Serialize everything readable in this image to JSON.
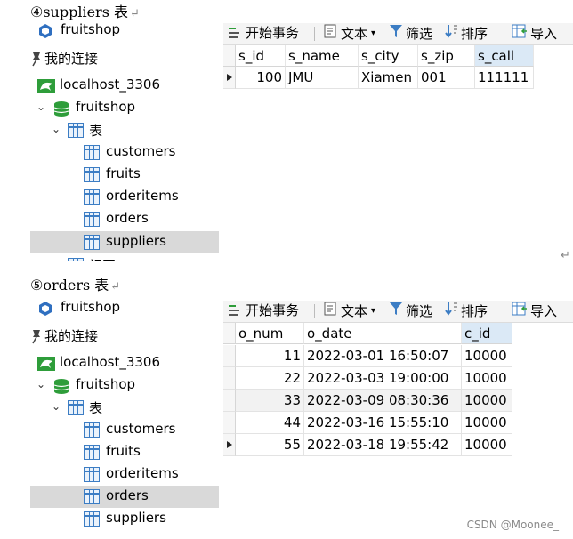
{
  "section1": {
    "heading": "④suppliers 表",
    "tree": {
      "root_label": "fruitshop",
      "connection_label": "我的连接",
      "server_label": "localhost_3306",
      "db_label": "fruitshop",
      "tables_label": "表",
      "tables": [
        "customers",
        "fruits",
        "orderitems",
        "orders",
        "suppliers"
      ],
      "selected": "suppliers",
      "partial_label": "视图"
    },
    "toolbar": {
      "begin_tx": "开始事务",
      "text": "文本",
      "filter": "筛选",
      "sort": "排序",
      "import": "导入"
    },
    "grid": {
      "columns": [
        "s_id",
        "s_name",
        "s_city",
        "s_zip",
        "s_call"
      ],
      "active_column": "s_call",
      "rows": [
        [
          "100",
          "JMU",
          "Xiamen",
          "001",
          "111111"
        ]
      ]
    }
  },
  "section2": {
    "heading": "⑤orders 表",
    "tree": {
      "root_label": "fruitshop",
      "connection_label": "我的连接",
      "server_label": "localhost_3306",
      "db_label": "fruitshop",
      "tables_label": "表",
      "tables": [
        "customers",
        "fruits",
        "orderitems",
        "orders",
        "suppliers"
      ],
      "selected": "orders"
    },
    "toolbar": {
      "begin_tx": "开始事务",
      "text": "文本",
      "filter": "筛选",
      "sort": "排序",
      "import": "导入"
    },
    "grid": {
      "columns": [
        "o_num",
        "o_date",
        "c_id"
      ],
      "active_column": "c_id",
      "rows": [
        [
          "11",
          "2022-03-01 16:50:07",
          "10000"
        ],
        [
          "22",
          "2022-03-03 19:00:00",
          "10000"
        ],
        [
          "33",
          "2022-03-09 08:30:36",
          "10000"
        ],
        [
          "44",
          "2022-03-16 15:55:10",
          "10000"
        ],
        [
          "55",
          "2022-03-18 19:55:42",
          "10000"
        ]
      ]
    }
  },
  "watermark": "CSDN @Moonee_",
  "colors": {
    "selection": "#d9d9d9",
    "active_header": "#dbe9f6",
    "db_green": "#2e9d3a",
    "table_blue": "#3c7dc4"
  }
}
